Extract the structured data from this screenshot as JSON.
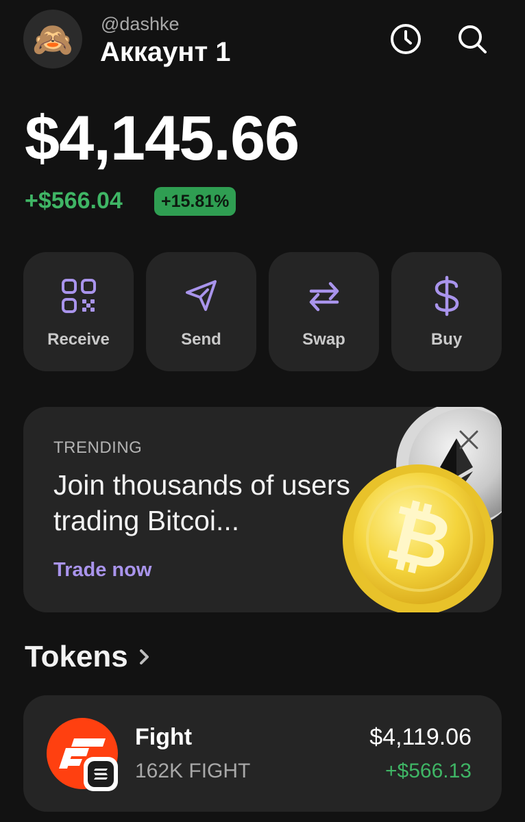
{
  "header": {
    "avatar_emoji": "🙈",
    "handle": "@dashke",
    "account_name": "Аккаунт 1",
    "icons": [
      "history-icon",
      "search-icon"
    ]
  },
  "portfolio": {
    "balance": "$4,145.66",
    "change_amount": "+$566.04",
    "change_percent": "+15.81%",
    "change_percent_value": 15.81
  },
  "actions": [
    {
      "label": "Receive",
      "icon": "qr-code-icon"
    },
    {
      "label": "Send",
      "icon": "send-icon"
    },
    {
      "label": "Swap",
      "icon": "swap-icon"
    },
    {
      "label": "Buy",
      "icon": "dollar-icon"
    }
  ],
  "trending": {
    "kicker": "TRENDING",
    "title": "Join thousands of users trading Bitcoi...",
    "cta": "Trade now",
    "images": [
      "ethereum-coin",
      "bitcoin-coin"
    ]
  },
  "tokens": {
    "title": "Tokens",
    "items": [
      {
        "name": "Fight",
        "amount": "162K FIGHT",
        "value": "$4,119.06",
        "change": "+$566.13"
      }
    ]
  },
  "colors": {
    "background": "#121212",
    "card": "#252525",
    "positive": "#3fb565",
    "accent": "#a994ec",
    "token_logo": "#ff4010"
  }
}
